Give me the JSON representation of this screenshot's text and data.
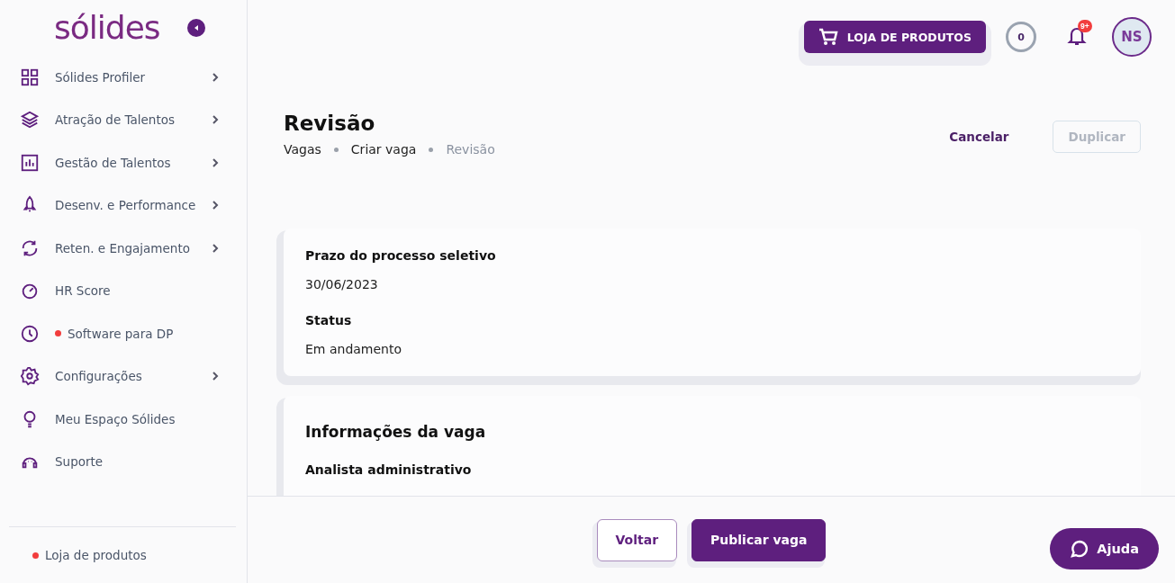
{
  "sidebar": {
    "logo": "sólides",
    "items": [
      {
        "label": "Sólides Profiler",
        "submenu": true,
        "dot": false
      },
      {
        "label": "Atração de Talentos",
        "submenu": true,
        "dot": false
      },
      {
        "label": "Gestão de Talentos",
        "submenu": true,
        "dot": false
      },
      {
        "label": "Desenv. e Performance",
        "submenu": true,
        "dot": false
      },
      {
        "label": "Reten. e Engajamento",
        "submenu": true,
        "dot": false
      },
      {
        "label": "HR Score",
        "submenu": false,
        "dot": false
      },
      {
        "label": "Software para DP",
        "submenu": false,
        "dot": true
      },
      {
        "label": "Configurações",
        "submenu": true,
        "dot": false
      },
      {
        "label": "Meu Espaço Sólides",
        "submenu": false,
        "dot": false
      },
      {
        "label": "Suporte",
        "submenu": false,
        "dot": false
      }
    ],
    "footer_link": {
      "label": "Loja de produtos",
      "dot": true
    }
  },
  "header": {
    "store_button": "LOJA DE PRODUTOS",
    "counter": "0",
    "notifications_badge": "9+",
    "avatar": "NS"
  },
  "page": {
    "title": "Revisão",
    "breadcrumbs": [
      {
        "label": "Vagas",
        "current": false
      },
      {
        "label": "Criar vaga",
        "current": false
      },
      {
        "label": "Revisão",
        "current": true
      }
    ],
    "actions": [
      {
        "label": "Cancelar",
        "disabled": false
      },
      {
        "label": "Duplicar",
        "disabled": true
      }
    ]
  },
  "cards": [
    {
      "fields": [
        {
          "label": "Prazo do processo seletivo",
          "value": "30/06/2023"
        },
        {
          "label": "Status",
          "value": "Em andamento"
        }
      ]
    },
    {
      "title": "Informações da vaga",
      "fields": [
        {
          "label": "Analista administrativo"
        }
      ]
    }
  ],
  "footer": {
    "buttons": [
      {
        "label": "Voltar",
        "primary": false
      },
      {
        "label": "Publicar vaga",
        "primary": true
      }
    ],
    "help": "Ajuda"
  }
}
